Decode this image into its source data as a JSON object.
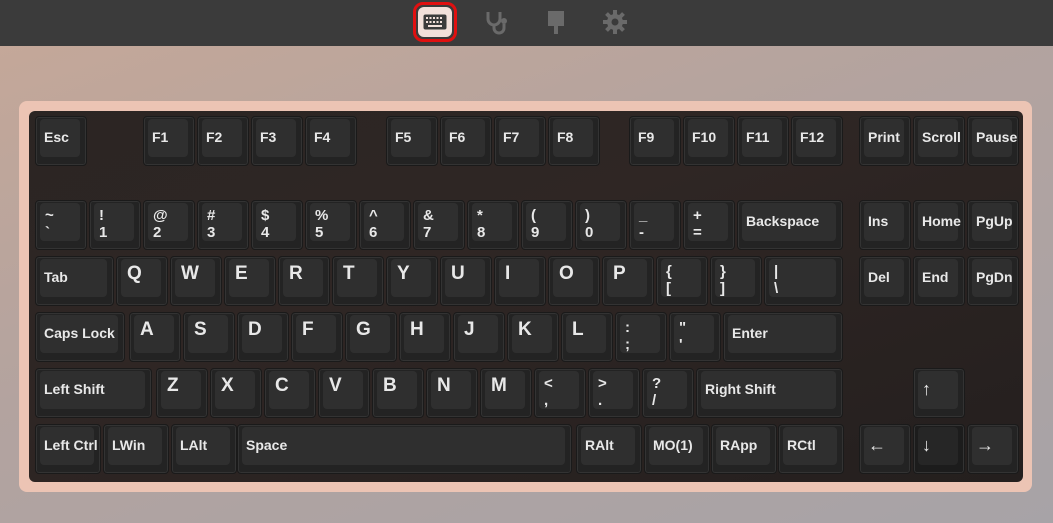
{
  "toolbar": {
    "tabs": [
      {
        "name": "keyboard-icon",
        "active": true
      },
      {
        "name": "stethoscope-icon",
        "active": false
      },
      {
        "name": "brush-icon",
        "active": false
      },
      {
        "name": "gear-icon",
        "active": false
      }
    ]
  },
  "keyboard": {
    "rows": {
      "fn": [
        "Esc",
        "F1",
        "F2",
        "F3",
        "F4",
        "F5",
        "F6",
        "F7",
        "F8",
        "F9",
        "F10",
        "F11",
        "F12",
        "Print",
        "Scroll",
        "Pause"
      ],
      "num": [
        {
          "top": "~",
          "bot": "`"
        },
        {
          "top": "!",
          "bot": "1"
        },
        {
          "top": "@",
          "bot": "2"
        },
        {
          "top": "#",
          "bot": "3"
        },
        {
          "top": "$",
          "bot": "4"
        },
        {
          "top": "%",
          "bot": "5"
        },
        {
          "top": "^",
          "bot": "6"
        },
        {
          "top": "&",
          "bot": "7"
        },
        {
          "top": "*",
          "bot": "8"
        },
        {
          "top": "(",
          "bot": "9"
        },
        {
          "top": ")",
          "bot": "0"
        },
        {
          "top": "_",
          "bot": "-"
        },
        {
          "top": "+",
          "bot": "="
        },
        {
          "label": "Backspace"
        },
        {
          "label": "Ins"
        },
        {
          "label": "Home"
        },
        {
          "label": "PgUp"
        }
      ],
      "tab": [
        {
          "label": "Tab"
        },
        {
          "big": "Q"
        },
        {
          "big": "W"
        },
        {
          "big": "E"
        },
        {
          "big": "R"
        },
        {
          "big": "T"
        },
        {
          "big": "Y"
        },
        {
          "big": "U"
        },
        {
          "big": "I"
        },
        {
          "big": "O"
        },
        {
          "big": "P"
        },
        {
          "top": "{",
          "bot": "["
        },
        {
          "top": "}",
          "bot": "]"
        },
        {
          "top": "|",
          "bot": "\\"
        },
        {
          "label": "Del"
        },
        {
          "label": "End"
        },
        {
          "label": "PgDn"
        }
      ],
      "caps": [
        {
          "label": "Caps Lock"
        },
        {
          "big": "A"
        },
        {
          "big": "S"
        },
        {
          "big": "D"
        },
        {
          "big": "F"
        },
        {
          "big": "G"
        },
        {
          "big": "H"
        },
        {
          "big": "J"
        },
        {
          "big": "K"
        },
        {
          "big": "L"
        },
        {
          "top": ":",
          "bot": ";"
        },
        {
          "top": "\"",
          "bot": "'"
        },
        {
          "label": "Enter"
        }
      ],
      "shift": [
        {
          "label": "Left Shift"
        },
        {
          "big": "Z"
        },
        {
          "big": "X"
        },
        {
          "big": "C"
        },
        {
          "big": "V"
        },
        {
          "big": "B"
        },
        {
          "big": "N"
        },
        {
          "big": "M"
        },
        {
          "top": "<",
          "bot": ","
        },
        {
          "top": ">",
          "bot": "."
        },
        {
          "top": "?",
          "bot": "/"
        },
        {
          "label": "Right Shift"
        },
        {
          "label": "↑"
        }
      ],
      "bottom": [
        {
          "label": "Left Ctrl"
        },
        {
          "label": "LWin"
        },
        {
          "label": "LAlt"
        },
        {
          "label": "Space"
        },
        {
          "label": "RAlt"
        },
        {
          "label": "MO(1)"
        },
        {
          "label": "RApp"
        },
        {
          "label": "RCtl"
        },
        {
          "label": "←"
        },
        {
          "label": "↓"
        },
        {
          "label": "→"
        }
      ]
    }
  }
}
